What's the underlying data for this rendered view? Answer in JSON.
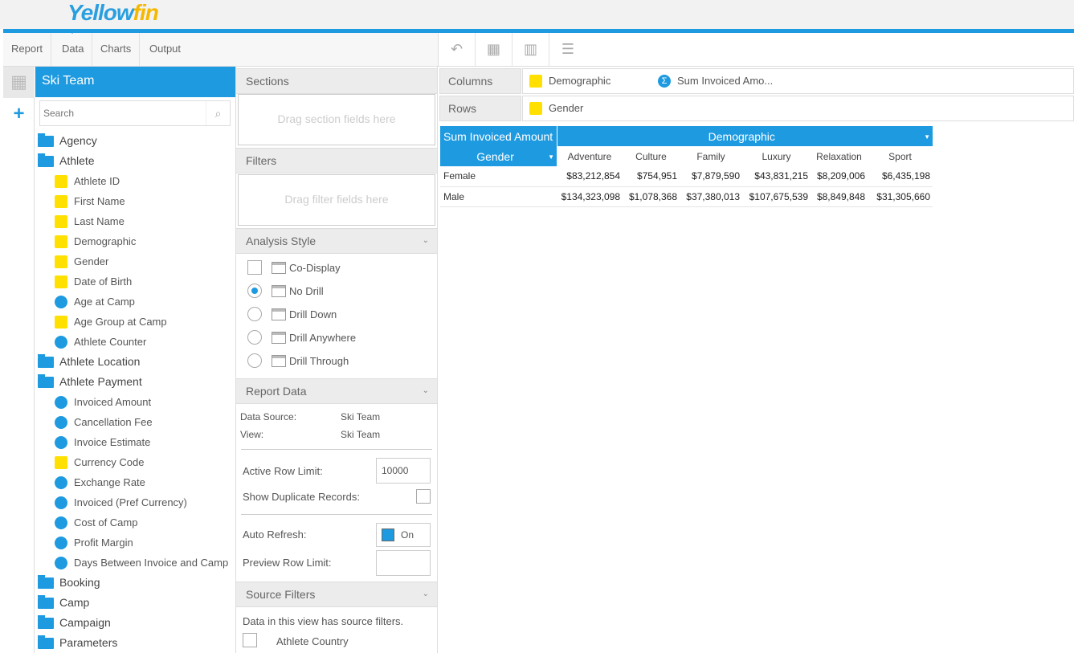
{
  "app": {
    "logo_part1": "Ye",
    "logo_part2": "llow",
    "logo_part3": "fin"
  },
  "menu": {
    "items": [
      {
        "label": "Report"
      },
      {
        "label": "Data"
      },
      {
        "label": "Charts"
      },
      {
        "label": "Output"
      }
    ],
    "active": "Data"
  },
  "toolbar": {
    "icons": [
      "undo-icon",
      "table-icon",
      "column-icon",
      "list-icon"
    ]
  },
  "fieldpanel": {
    "title": "Ski Team",
    "search_placeholder": "Search",
    "tree": [
      {
        "type": "folder",
        "label": "Agency"
      },
      {
        "type": "folder",
        "label": "Athlete"
      },
      {
        "type": "dim",
        "label": "Athlete ID"
      },
      {
        "type": "dim",
        "label": "First Name"
      },
      {
        "type": "dim",
        "label": "Last Name"
      },
      {
        "type": "dim",
        "label": "Demographic"
      },
      {
        "type": "dim",
        "label": "Gender"
      },
      {
        "type": "dim",
        "label": "Date of Birth"
      },
      {
        "type": "metric",
        "label": "Age at Camp"
      },
      {
        "type": "dim",
        "label": "Age Group at Camp"
      },
      {
        "type": "metric",
        "label": "Athlete Counter"
      },
      {
        "type": "folder",
        "label": "Athlete Location"
      },
      {
        "type": "folder",
        "label": "Athlete Payment"
      },
      {
        "type": "metric",
        "label": "Invoiced Amount"
      },
      {
        "type": "metric",
        "label": "Cancellation Fee"
      },
      {
        "type": "metric",
        "label": "Invoice Estimate"
      },
      {
        "type": "dim",
        "label": "Currency Code"
      },
      {
        "type": "metric",
        "label": "Exchange Rate"
      },
      {
        "type": "metric",
        "label": "Invoiced (Pref Currency)"
      },
      {
        "type": "metric",
        "label": "Cost of Camp"
      },
      {
        "type": "metric",
        "label": "Profit Margin"
      },
      {
        "type": "metric",
        "label": "Days Between Invoice and Camp"
      },
      {
        "type": "folder",
        "label": "Booking"
      },
      {
        "type": "folder",
        "label": "Camp"
      },
      {
        "type": "folder",
        "label": "Campaign"
      },
      {
        "type": "folder",
        "label": "Parameters"
      }
    ]
  },
  "middle": {
    "sections_title": "Sections",
    "sections_drop": "Drag section fields here",
    "filters_title": "Filters",
    "filters_drop": "Drag filter fields here",
    "analysis_title": "Analysis Style",
    "analysis_options": [
      {
        "label": "Co-Display",
        "control": "checkbox",
        "checked": false
      },
      {
        "label": "No Drill",
        "control": "radio",
        "checked": true
      },
      {
        "label": "Drill Down",
        "control": "radio",
        "checked": false
      },
      {
        "label": "Drill Anywhere",
        "control": "radio",
        "checked": false
      },
      {
        "label": "Drill Through",
        "control": "radio",
        "checked": false
      }
    ],
    "report_data_title": "Report Data",
    "data_source_label": "Data Source:",
    "data_source_value": "Ski Team",
    "view_label": "View:",
    "view_value": "Ski Team",
    "active_row_limit_label": "Active Row Limit:",
    "active_row_limit_value": "10000",
    "show_duplicates_label": "Show Duplicate Records:",
    "auto_refresh_label": "Auto Refresh:",
    "auto_refresh_value": "On",
    "preview_row_limit_label": "Preview Row Limit:",
    "preview_row_limit_value": "",
    "source_filters_title": "Source Filters",
    "source_filters_note": "Data in this view has source filters.",
    "source_filter_item": "Athlete Country"
  },
  "canvas": {
    "columns_label": "Columns",
    "columns_fields": [
      {
        "type": "dim",
        "label": "Demographic"
      },
      {
        "type": "sum",
        "label": "Sum Invoiced Amo..."
      }
    ],
    "rows_label": "Rows",
    "rows_fields": [
      {
        "type": "dim",
        "label": "Gender"
      }
    ],
    "table": {
      "metric_header": "Sum Invoiced Amount",
      "col_dimension": "Demographic",
      "row_dimension": "Gender",
      "columns": [
        "Adventure",
        "Culture",
        "Family",
        "Luxury",
        "Relaxation",
        "Sport"
      ],
      "rows": [
        {
          "label": "Female",
          "values": [
            "$83,212,854",
            "$754,951",
            "$7,879,590",
            "$43,831,215",
            "$8,209,006",
            "$6,435,198"
          ]
        },
        {
          "label": "Male",
          "values": [
            "$134,323,098",
            "$1,078,368",
            "$37,380,013",
            "$107,675,539",
            "$8,849,848",
            "$31,305,660"
          ]
        }
      ]
    }
  },
  "colors": {
    "accent": "#1e9ae0",
    "dimension": "#ffe000",
    "logo_yellow": "#f5b800"
  }
}
